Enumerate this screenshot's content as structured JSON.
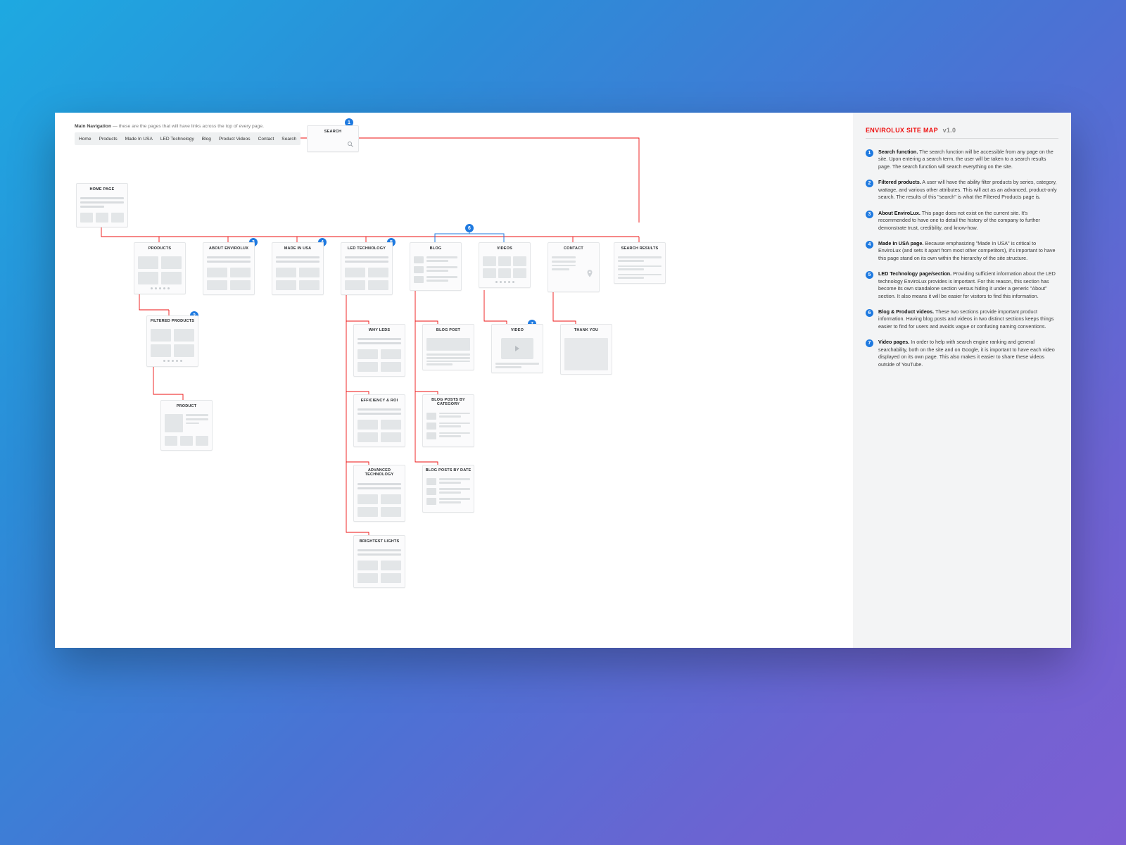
{
  "sidebar": {
    "title": "ENVIROLUX SITE MAP",
    "version": "v1.0",
    "notes": [
      {
        "n": "1",
        "lead": "Search function.",
        "body": " The search function will be accessible from any page on the site. Upon entering a search term, the user will be taken to a search results page. The search function will search everything on the site."
      },
      {
        "n": "2",
        "lead": "Filtered products.",
        "body": " A user will have the ability filter products by series, category, wattage, and various other attributes. This will act as an advanced, product-only search. The results of this \"search\" is what the Filtered Products page is."
      },
      {
        "n": "3",
        "lead": "About EnviroLux.",
        "body": " This page does not exist on the current site. It's recommended to have one to detail the history of the company to further demonstrate trust, credibility, and know-how."
      },
      {
        "n": "4",
        "lead": "Made In USA page.",
        "body": " Because emphasizing \"Made In USA\" is critical to EnviroLux (and sets it apart from most other competitors), it's important to have this page stand on its own within the hierarchy of the site structure."
      },
      {
        "n": "5",
        "lead": "LED Technology page/section.",
        "body": " Providing sufficient information about the LED technology EnviroLux provides is important. For this reason, this section has become its own standalone section versus hiding it under a generic \"About\" section. It also means it will be easier for visitors to find this information."
      },
      {
        "n": "6",
        "lead": "Blog & Product videos.",
        "body": " These two sections provide important product information. Having blog posts and videos in two distinct sections keeps things easier to find for users and avoids vague or confusing naming conventions."
      },
      {
        "n": "7",
        "lead": "Video pages.",
        "body": " In order to help with search engine ranking and general searchability, both on the site and on Google, it is important to have each video displayed on its own page. This also makes it easier to share these videos outside of YouTube."
      }
    ]
  },
  "nav": {
    "caption_lead": "Main Navigation",
    "caption_rest": " — these are the pages that will have links across the top of every page.",
    "items": [
      "Home",
      "Products",
      "Made In USA",
      "LED Technology",
      "Blog",
      "Product Videos",
      "Contact",
      "Search"
    ]
  },
  "cards": {
    "search": "SEARCH",
    "home": "HOME PAGE",
    "products": "PRODUCTS",
    "about": "ABOUT ENVIROLUX",
    "usa": "MADE IN USA",
    "led": "LED TECHNOLOGY",
    "blog": "BLOG",
    "videos": "VIDEOS",
    "contact": "CONTACT",
    "results": "SEARCH RESULTS",
    "filtered": "FILTERED PRODUCTS",
    "product": "PRODUCT",
    "whyleds": "WHY LEDS",
    "eff": "EFFICIENCY & ROI",
    "adv": "ADVANCED TECHNOLOGY",
    "bright": "BRIGHTEST LIGHTS",
    "post": "BLOG POST",
    "postcat": "BLOG POSTS BY CATEGORY",
    "postdate": "BLOG POSTS BY DATE",
    "video": "VIDEO",
    "thanks": "THANK YOU"
  },
  "tags": {
    "t1": "1",
    "t2": "2",
    "t3": "3",
    "t4": "4",
    "t5": "5",
    "t6": "6",
    "t7": "7"
  }
}
